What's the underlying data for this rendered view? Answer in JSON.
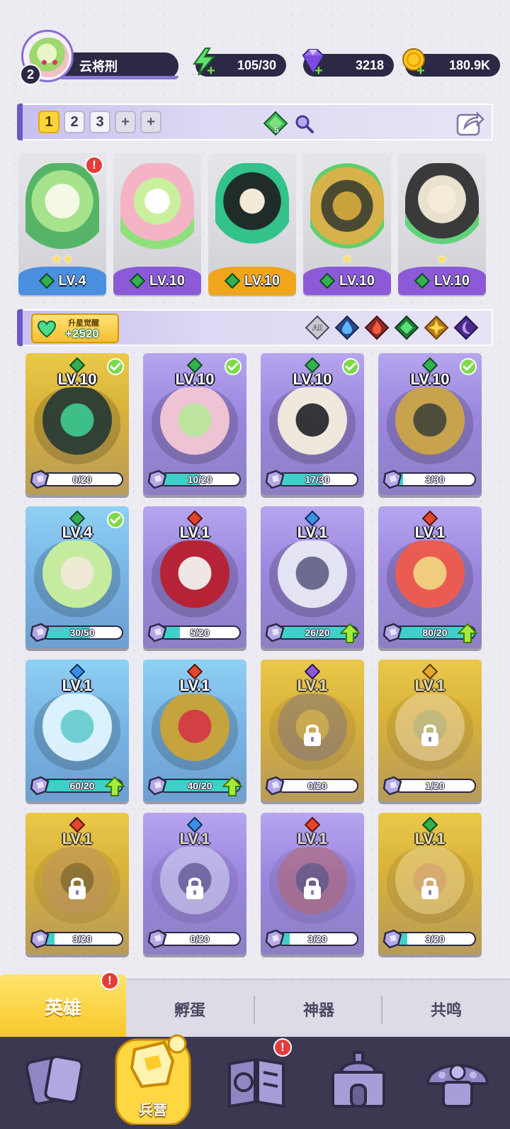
{
  "player": {
    "level": "2",
    "name": "云将刑"
  },
  "resources": {
    "energy": "105/30",
    "gems": "3218",
    "gold": "180.9K"
  },
  "teams": {
    "tabs": [
      "1",
      "2",
      "3",
      "+",
      "+"
    ],
    "active_index": 0,
    "power_badge": "5"
  },
  "lineup": [
    {
      "level": "LV.4",
      "strip_color": "#4a8fe0",
      "stars": "★★",
      "alert": "!"
    },
    {
      "level": "LV.10",
      "strip_color": "#8c5ad8",
      "stars": "",
      "alert": ""
    },
    {
      "level": "LV.10",
      "strip_color": "#f1a51c",
      "stars": "",
      "alert": ""
    },
    {
      "level": "LV.10",
      "strip_color": "#8c5ad8",
      "stars": "★",
      "alert": ""
    },
    {
      "level": "LV.10",
      "strip_color": "#8c5ad8",
      "stars": "★",
      "alert": ""
    }
  ],
  "awaken": {
    "label": "升星觉醒",
    "value": "+2520"
  },
  "filters": [
    {
      "name": "all",
      "label": "All"
    },
    {
      "name": "water"
    },
    {
      "name": "fire"
    },
    {
      "name": "nature"
    },
    {
      "name": "light"
    },
    {
      "name": "dark"
    }
  ],
  "heroes": [
    {
      "level": "LV.10",
      "element": "nature",
      "progress": "0/20",
      "fill": 0,
      "bg": "gold",
      "check": true,
      "up": false,
      "locked": false
    },
    {
      "level": "LV.10",
      "element": "nature",
      "progress": "10/20",
      "fill": 0.5,
      "bg": "purple",
      "check": true,
      "up": false,
      "locked": false
    },
    {
      "level": "LV.10",
      "element": "nature",
      "progress": "17/30",
      "fill": 0.57,
      "bg": "purple",
      "check": true,
      "up": false,
      "locked": false
    },
    {
      "level": "LV.10",
      "element": "nature",
      "progress": "3/30",
      "fill": 0.1,
      "bg": "purple",
      "check": true,
      "up": false,
      "locked": false
    },
    {
      "level": "LV.4",
      "element": "nature",
      "progress": "30/50",
      "fill": 0.6,
      "bg": "blue",
      "check": true,
      "up": false,
      "locked": false
    },
    {
      "level": "LV.1",
      "element": "fire",
      "progress": "5/20",
      "fill": 0.25,
      "bg": "purple",
      "check": false,
      "up": false,
      "locked": false
    },
    {
      "level": "LV.1",
      "element": "water",
      "progress": "26/20",
      "fill": 1,
      "bg": "purple",
      "check": false,
      "up": true,
      "locked": false
    },
    {
      "level": "LV.1",
      "element": "fire",
      "progress": "80/20",
      "fill": 1,
      "bg": "purple",
      "check": false,
      "up": true,
      "locked": false
    },
    {
      "level": "LV.1",
      "element": "water",
      "progress": "60/20",
      "fill": 1,
      "bg": "blue",
      "check": false,
      "up": true,
      "locked": false
    },
    {
      "level": "LV.1",
      "element": "fire",
      "progress": "40/20",
      "fill": 1,
      "bg": "blue",
      "check": false,
      "up": true,
      "locked": false
    },
    {
      "level": "LV.1",
      "element": "dark",
      "progress": "0/20",
      "fill": 0,
      "bg": "gold",
      "check": false,
      "up": false,
      "locked": true
    },
    {
      "level": "LV.1",
      "element": "light",
      "progress": "1/20",
      "fill": 0.05,
      "bg": "gold",
      "check": false,
      "up": false,
      "locked": true
    },
    {
      "level": "LV.1",
      "element": "fire",
      "progress": "3/20",
      "fill": 0.15,
      "bg": "gold",
      "check": false,
      "up": false,
      "locked": true
    },
    {
      "level": "LV.1",
      "element": "water",
      "progress": "0/20",
      "fill": 0,
      "bg": "purple",
      "check": false,
      "up": false,
      "locked": true
    },
    {
      "level": "LV.1",
      "element": "fire",
      "progress": "3/20",
      "fill": 0.15,
      "bg": "purple",
      "check": false,
      "up": false,
      "locked": true
    },
    {
      "level": "LV.1",
      "element": "nature",
      "progress": "3/20",
      "fill": 0.15,
      "bg": "gold",
      "check": false,
      "up": false,
      "locked": true
    }
  ],
  "subtabs": [
    "英雄",
    "孵蛋",
    "神器",
    "共鸣"
  ],
  "subtab_alert": "!",
  "nav": [
    {
      "name": "cards",
      "label": ""
    },
    {
      "name": "barracks",
      "label": "兵营"
    },
    {
      "name": "map",
      "label": "",
      "alert": "!"
    },
    {
      "name": "castle",
      "label": ""
    },
    {
      "name": "mushroom-house",
      "label": ""
    }
  ],
  "colors": {
    "accent_purple": "#6b57c6",
    "dark_panel": "#2c2945",
    "gold": "#f7c72a",
    "alert_red": "#e43c3c",
    "progress_teal": "#3fd1c9"
  }
}
